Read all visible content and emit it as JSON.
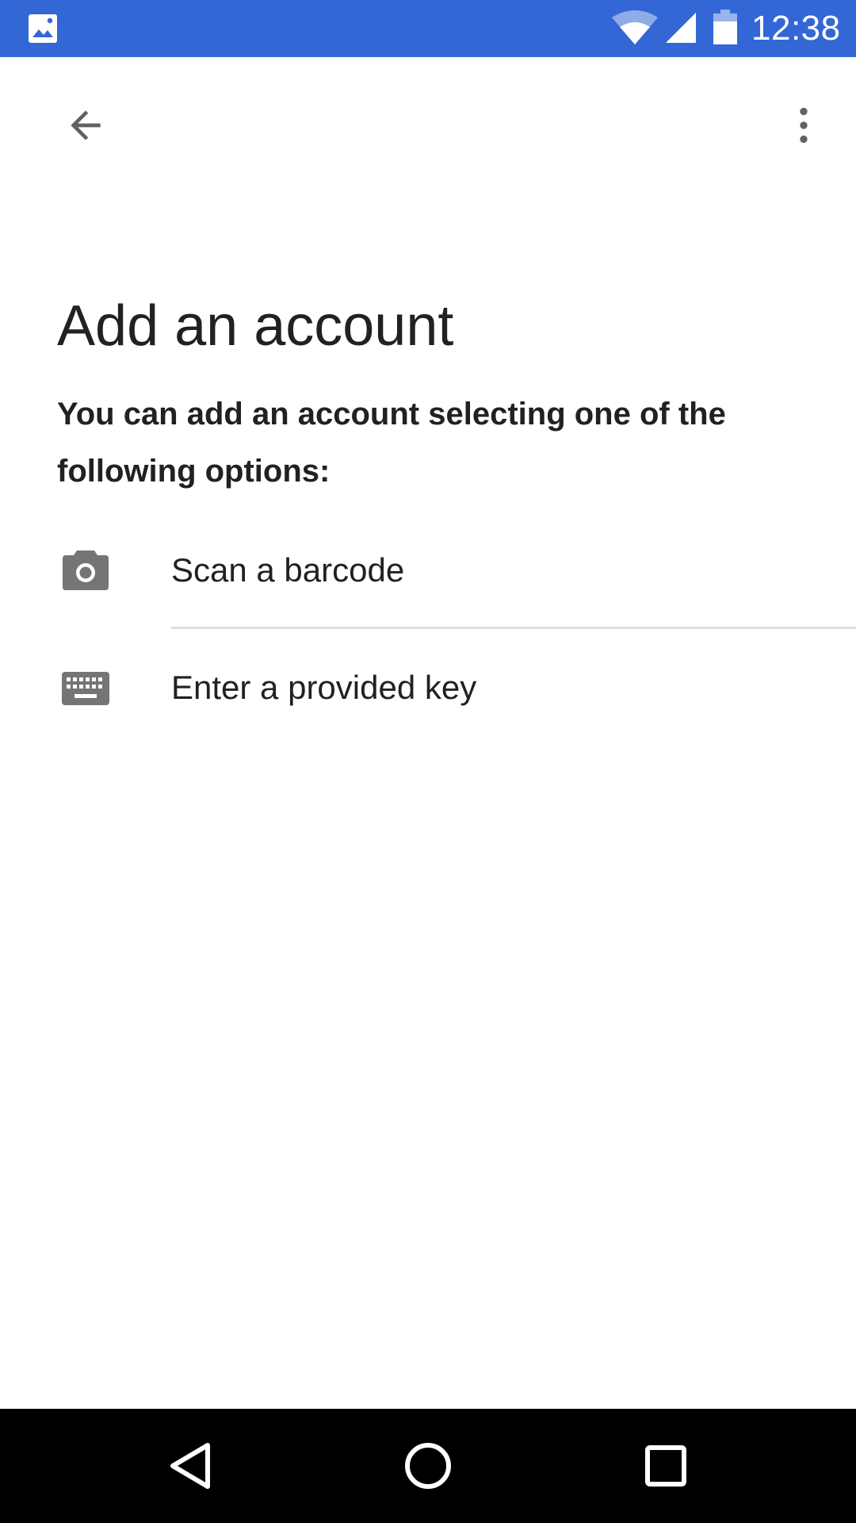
{
  "status_bar": {
    "time": "12:38",
    "background_color": "#3367d6",
    "icons": [
      "image-notification-icon",
      "wifi-icon",
      "signal-icon",
      "battery-icon"
    ]
  },
  "toolbar": {
    "back_icon": "arrow-back-icon",
    "menu_icon": "more-vert-icon"
  },
  "main": {
    "title": "Add an account",
    "subtitle": "You can add an account selecting one of the following options:",
    "options": [
      {
        "label": "Scan a barcode",
        "icon": "camera-icon"
      },
      {
        "label": "Enter a provided key",
        "icon": "keyboard-icon"
      }
    ]
  },
  "nav_bar": {
    "icons": [
      "nav-back-icon",
      "nav-home-icon",
      "nav-recents-icon"
    ]
  }
}
